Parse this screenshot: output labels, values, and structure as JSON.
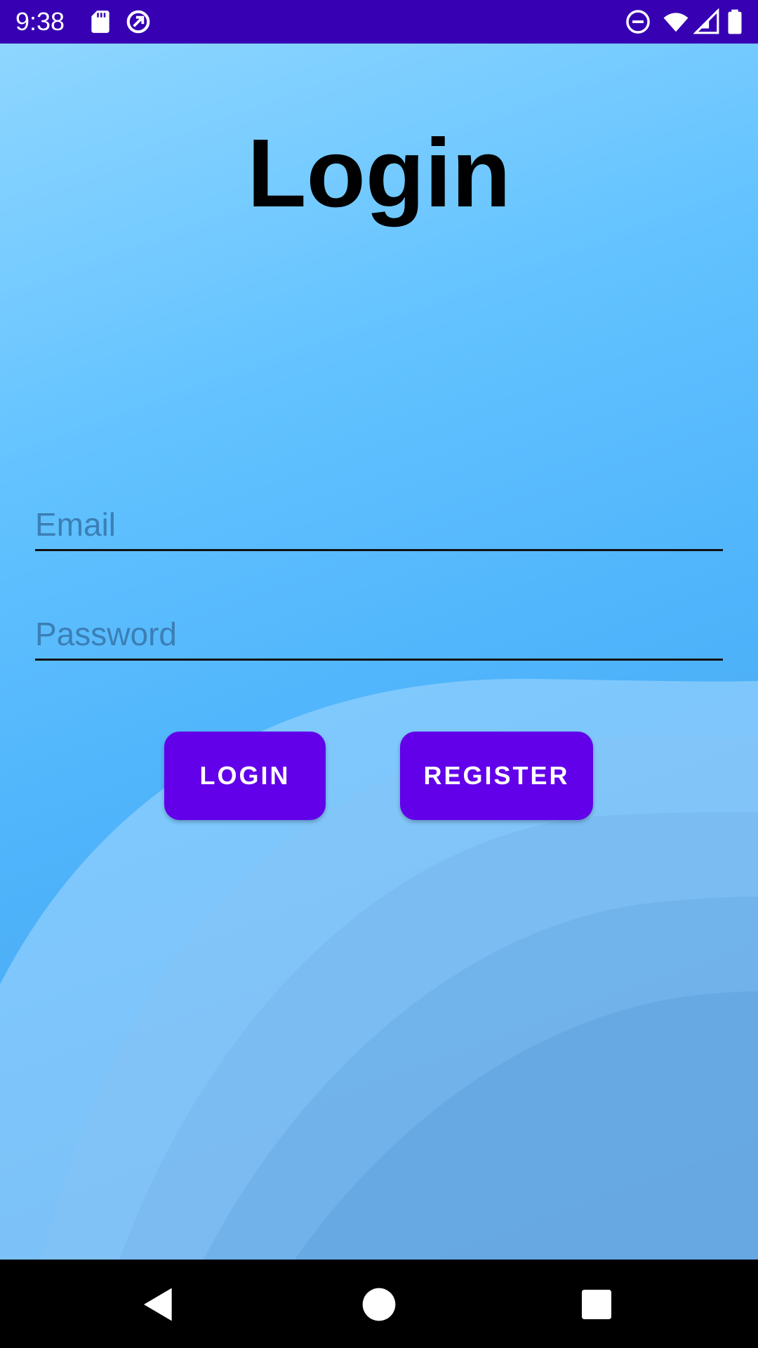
{
  "status_bar": {
    "time": "9:38",
    "left_icons": [
      "sd-card-icon",
      "data-saver-icon"
    ],
    "right_icons": [
      "do-not-disturb-icon",
      "wifi-icon",
      "signal-icon",
      "battery-icon"
    ]
  },
  "login_screen": {
    "title": "Login",
    "email_field": {
      "placeholder": "Email",
      "value": ""
    },
    "password_field": {
      "placeholder": "Password",
      "value": ""
    },
    "login_button": "LOGIN",
    "register_button": "REGISTER"
  },
  "nav_bar": {
    "icons": [
      "back-icon",
      "home-icon",
      "recents-icon"
    ]
  },
  "colors": {
    "status_bar": "#3700b3",
    "accent": "#6200ea",
    "background_top": "#8ed6ff",
    "background_bottom": "#4b99e0"
  }
}
